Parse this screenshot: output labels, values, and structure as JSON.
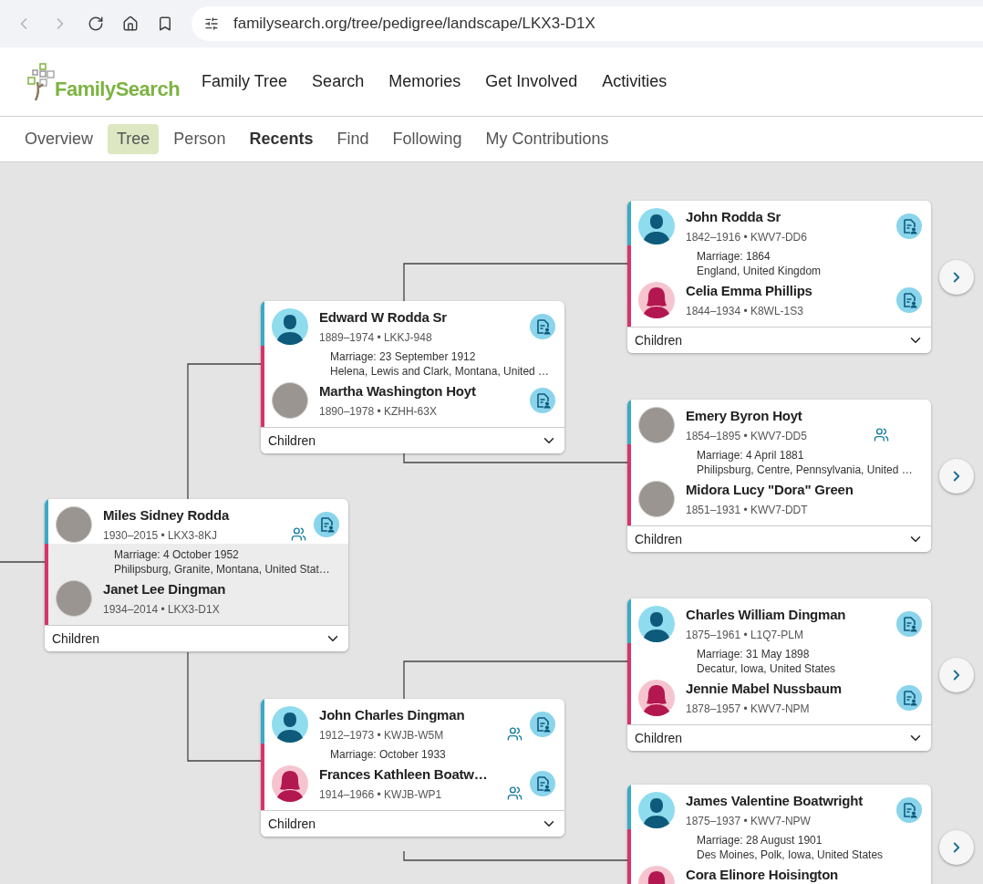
{
  "browser": {
    "url": "familysearch.org/tree/pedigree/landscape/LKX3-D1X"
  },
  "header": {
    "logo": "FamilySearch",
    "nav": [
      "Family Tree",
      "Search",
      "Memories",
      "Get Involved",
      "Activities"
    ]
  },
  "tabs": [
    {
      "label": "Overview",
      "selected": false,
      "emphasized": false
    },
    {
      "label": "Tree",
      "selected": true,
      "emphasized": false
    },
    {
      "label": "Person",
      "selected": false,
      "emphasized": false
    },
    {
      "label": "Recents",
      "selected": false,
      "emphasized": true
    },
    {
      "label": "Find",
      "selected": false,
      "emphasized": false
    },
    {
      "label": "Following",
      "selected": false,
      "emphasized": false
    },
    {
      "label": "My Contributions",
      "selected": false,
      "emphasized": false
    }
  ],
  "couples": [
    {
      "selected": true,
      "expand_button": false,
      "children_label": "Children",
      "marriage": [
        "Marriage: 4 October 1952",
        "Philipsburg, Granite, Montana, United Stat…"
      ],
      "husband": {
        "name": "Miles Sidney Rodda",
        "dates": "1930–2015 • LKX3-8KJ",
        "avatar": {
          "kind": "photo"
        },
        "relatives_icon": true,
        "record_icon": true
      },
      "wife": {
        "name": "Janet Lee Dingman",
        "dates": "1934–2014 • LKX3-D1X",
        "avatar": {
          "kind": "photo"
        },
        "relatives_icon": false,
        "record_icon": false
      }
    },
    {
      "selected": false,
      "expand_button": false,
      "children_label": "Children",
      "marriage": [
        "Marriage: 23 September 1912",
        "Helena, Lewis and Clark, Montana, United …"
      ],
      "husband": {
        "name": "Edward W Rodda Sr",
        "dates": "1889–1974 • LKKJ-948",
        "avatar": {
          "kind": "male"
        },
        "relatives_icon": false,
        "record_icon": true
      },
      "wife": {
        "name": "Martha Washington Hoyt",
        "dates": "1890–1978 • KZHH-63X",
        "avatar": {
          "kind": "photo"
        },
        "relatives_icon": false,
        "record_icon": true
      }
    },
    {
      "selected": false,
      "expand_button": false,
      "children_label": "Children",
      "marriage": [
        "Marriage: October 1933"
      ],
      "husband": {
        "name": "John Charles Dingman",
        "dates": "1912–1973 • KWJB-W5M",
        "avatar": {
          "kind": "male"
        },
        "relatives_icon": true,
        "record_icon": true
      },
      "wife": {
        "name": "Frances Kathleen Boatw…",
        "dates": "1914–1966 • KWJB-WP1",
        "avatar": {
          "kind": "female"
        },
        "relatives_icon": true,
        "record_icon": true
      }
    },
    {
      "selected": false,
      "expand_button": true,
      "children_label": "Children",
      "marriage": [
        "Marriage: 1864",
        "England, United Kingdom"
      ],
      "husband": {
        "name": "John Rodda Sr",
        "dates": "1842–1916 • KWV7-DD6",
        "avatar": {
          "kind": "male"
        },
        "relatives_icon": false,
        "record_icon": true
      },
      "wife": {
        "name": "Celia Emma Phillips",
        "dates": "1844–1934 • K8WL-1S3",
        "avatar": {
          "kind": "female"
        },
        "relatives_icon": false,
        "record_icon": true
      }
    },
    {
      "selected": false,
      "expand_button": true,
      "children_label": "Children",
      "marriage": [
        "Marriage: 4 April 1881",
        "Philipsburg, Centre, Pennsylvania, United …"
      ],
      "husband": {
        "name": "Emery Byron Hoyt",
        "dates": "1854–1895 • KWV7-DD5",
        "avatar": {
          "kind": "photo"
        },
        "relatives_icon": true,
        "record_icon": false
      },
      "wife": {
        "name": "Midora Lucy \"Dora\" Green",
        "dates": "1851–1931 • KWV7-DDT",
        "avatar": {
          "kind": "photo"
        },
        "relatives_icon": false,
        "record_icon": false
      }
    },
    {
      "selected": false,
      "expand_button": true,
      "children_label": "Children",
      "marriage": [
        "Marriage: 31 May 1898",
        "Decatur, Iowa, United States"
      ],
      "husband": {
        "name": "Charles William Dingman",
        "dates": "1875–1961 • L1Q7-PLM",
        "avatar": {
          "kind": "male"
        },
        "relatives_icon": false,
        "record_icon": true
      },
      "wife": {
        "name": "Jennie Mabel Nussbaum",
        "dates": "1878–1957 • KWV7-NPM",
        "avatar": {
          "kind": "female"
        },
        "relatives_icon": false,
        "record_icon": true
      }
    },
    {
      "selected": false,
      "expand_button": true,
      "marriage": [
        "Marriage: 28 August 1901",
        "Des Moines, Polk, Iowa, United States"
      ],
      "husband": {
        "name": "James Valentine Boatwright",
        "dates": "1875–1937 • KWV7-NPW",
        "avatar": {
          "kind": "male"
        },
        "relatives_icon": false,
        "record_icon": true
      },
      "wife": {
        "name": "Cora Elinore Hoisington",
        "avatar": {
          "kind": "female"
        },
        "relatives_icon": false,
        "record_icon": false
      }
    }
  ]
}
